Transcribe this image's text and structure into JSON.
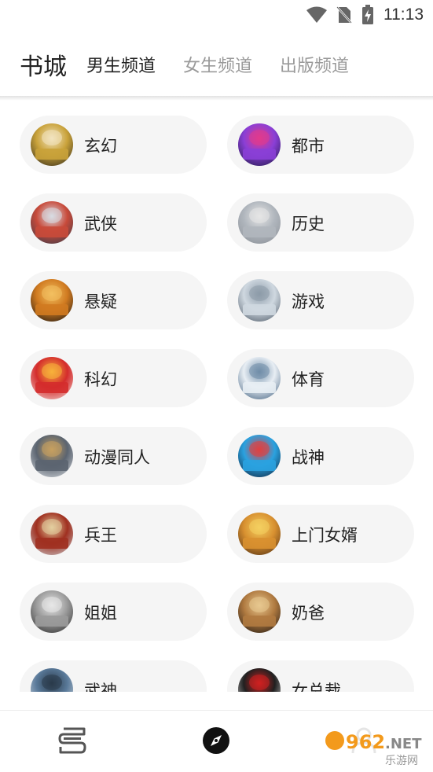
{
  "status_bar": {
    "time": "11:13",
    "icons": [
      "wifi-icon",
      "no-sim-icon",
      "battery-charging-icon"
    ]
  },
  "header": {
    "title": "书城",
    "tabs": [
      {
        "label": "男生频道",
        "active": true
      },
      {
        "label": "女生频道",
        "active": false
      },
      {
        "label": "出版频道",
        "active": false
      }
    ]
  },
  "categories": [
    {
      "label": "玄幻",
      "cover_colors": [
        "#2a2418",
        "#c9a23a",
        "#f2e4c0"
      ]
    },
    {
      "label": "都市",
      "cover_colors": [
        "#1a1640",
        "#8a3fd6",
        "#e23a8c"
      ]
    },
    {
      "label": "武侠",
      "cover_colors": [
        "#2f3a4a",
        "#c84a3a",
        "#d8dde4"
      ]
    },
    {
      "label": "历史",
      "cover_colors": [
        "#8a8f96",
        "#b0b6bd",
        "#e6e6e6"
      ]
    },
    {
      "label": "悬疑",
      "cover_colors": [
        "#121212",
        "#d07a20",
        "#f3c060"
      ]
    },
    {
      "label": "游戏",
      "cover_colors": [
        "#4a5664",
        "#cfd8e0",
        "#8c9aa8"
      ]
    },
    {
      "label": "科幻",
      "cover_colors": [
        "#f0d7d4",
        "#d42c2c",
        "#f7b23b"
      ]
    },
    {
      "label": "体育",
      "cover_colors": [
        "#3a5a7a",
        "#e8eef4",
        "#6f8da8"
      ]
    },
    {
      "label": "动漫同人",
      "cover_colors": [
        "#d9dde2",
        "#5b6470",
        "#c7a060"
      ]
    },
    {
      "label": "战神",
      "cover_colors": [
        "#0e1f38",
        "#2aa2e0",
        "#e04040"
      ]
    },
    {
      "label": "兵王",
      "cover_colors": [
        "#c8ccd0",
        "#a03020",
        "#e4d0a0"
      ]
    },
    {
      "label": "上门女婿",
      "cover_colors": [
        "#4a2a10",
        "#d89030",
        "#f4d060"
      ]
    },
    {
      "label": "姐姐",
      "cover_colors": [
        "#2b2b2b",
        "#9a9a9a",
        "#e8e8e8"
      ]
    },
    {
      "label": "奶爸",
      "cover_colors": [
        "#1a1410",
        "#b07a40",
        "#e8c890"
      ]
    },
    {
      "label": "武神",
      "cover_colors": [
        "#dfe3e8",
        "#5a7a9a",
        "#2a3a4a"
      ]
    },
    {
      "label": "女总裁",
      "cover_colors": [
        "#f0f0f0",
        "#202020",
        "#d02020"
      ]
    }
  ],
  "bottom_nav": [
    {
      "icon": "bookshelf-icon",
      "active": false
    },
    {
      "icon": "compass-icon",
      "active": true
    },
    {
      "icon": "profile-icon",
      "active": false
    }
  ],
  "watermark": {
    "text_top": "962.NET",
    "text_bottom": "乐游网"
  }
}
